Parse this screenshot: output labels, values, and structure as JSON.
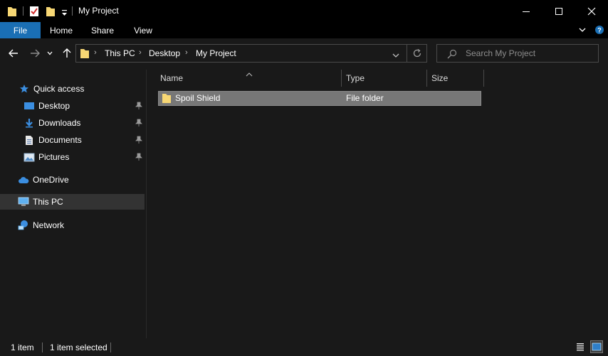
{
  "window": {
    "title": "My Project"
  },
  "ribbon": {
    "tabs": [
      "File",
      "Home",
      "Share",
      "View"
    ]
  },
  "address": {
    "breadcrumbs": [
      "This PC",
      "Desktop",
      "My Project"
    ]
  },
  "search": {
    "placeholder": "Search My Project"
  },
  "navigation": {
    "quick_access": "Quick access",
    "pinned": [
      {
        "label": "Desktop",
        "icon": "desktop-icon"
      },
      {
        "label": "Downloads",
        "icon": "downloads-icon"
      },
      {
        "label": "Documents",
        "icon": "documents-icon"
      },
      {
        "label": "Pictures",
        "icon": "pictures-icon"
      }
    ],
    "onedrive": "OneDrive",
    "this_pc": "This PC",
    "network": "Network"
  },
  "file_list": {
    "columns": [
      "Name",
      "Type",
      "Size"
    ],
    "rows": [
      {
        "name": "Spoil Shield",
        "type": "File folder",
        "size": ""
      }
    ]
  },
  "status": {
    "item_count": "1 item",
    "selected": "1 item selected"
  },
  "colors": {
    "accent": "#1a6fb5",
    "folder": "#f7d774",
    "selection": "#777777"
  }
}
